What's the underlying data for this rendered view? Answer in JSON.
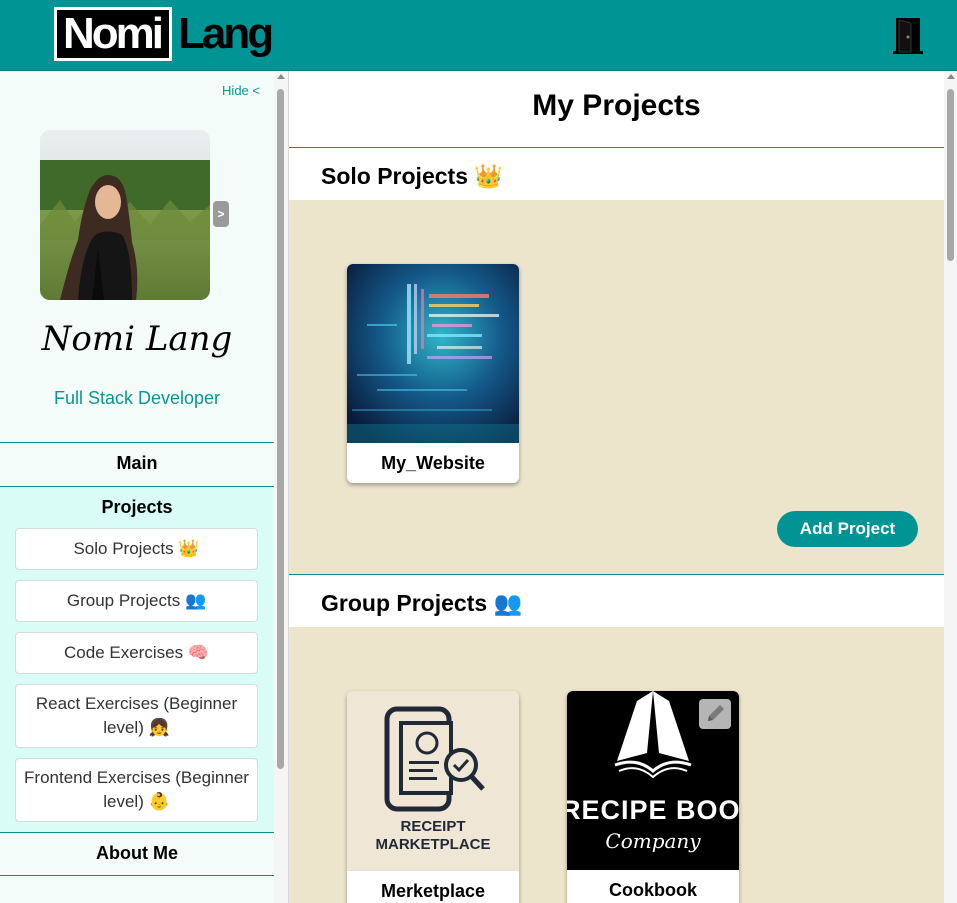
{
  "header": {
    "logo_part1": "Nomi",
    "logo_part2": "Lang",
    "logout_icon": "door-icon"
  },
  "sidebar": {
    "hide_label": "Hide <",
    "avatar_toggle": ">",
    "user_name": "Nomi Lang",
    "user_role": "Full Stack Developer",
    "main_label": "Main",
    "projects_label": "Projects",
    "sub_items": [
      {
        "label": "Solo Projects 👑"
      },
      {
        "label": "Group Projects 👥"
      },
      {
        "label": "Code Exercises 🧠"
      },
      {
        "label": "React Exercises (Beginner level) 👧"
      },
      {
        "label": "Frontend Exercises (Beginner level) 👶"
      }
    ],
    "about_label": "About Me"
  },
  "main": {
    "title": "My Projects",
    "solo": {
      "title": "Solo Projects 👑",
      "cards": [
        {
          "name": "My_Website"
        }
      ],
      "add_label": "Add Project"
    },
    "group": {
      "title": "Group Projects 👥",
      "cards": [
        {
          "name": "Merketplace",
          "logo_line1": "RECEIPT",
          "logo_line2": "MARKETPLACE"
        },
        {
          "name": "Cookbook",
          "logo_line1": "RECIPE BOOK",
          "logo_line2": "Company"
        }
      ]
    }
  },
  "colors": {
    "accent": "#009594",
    "section_bg": "#ede4cc",
    "sidebar_bg": "#f3fcf9",
    "projects_bg": "#d9fdf6"
  }
}
